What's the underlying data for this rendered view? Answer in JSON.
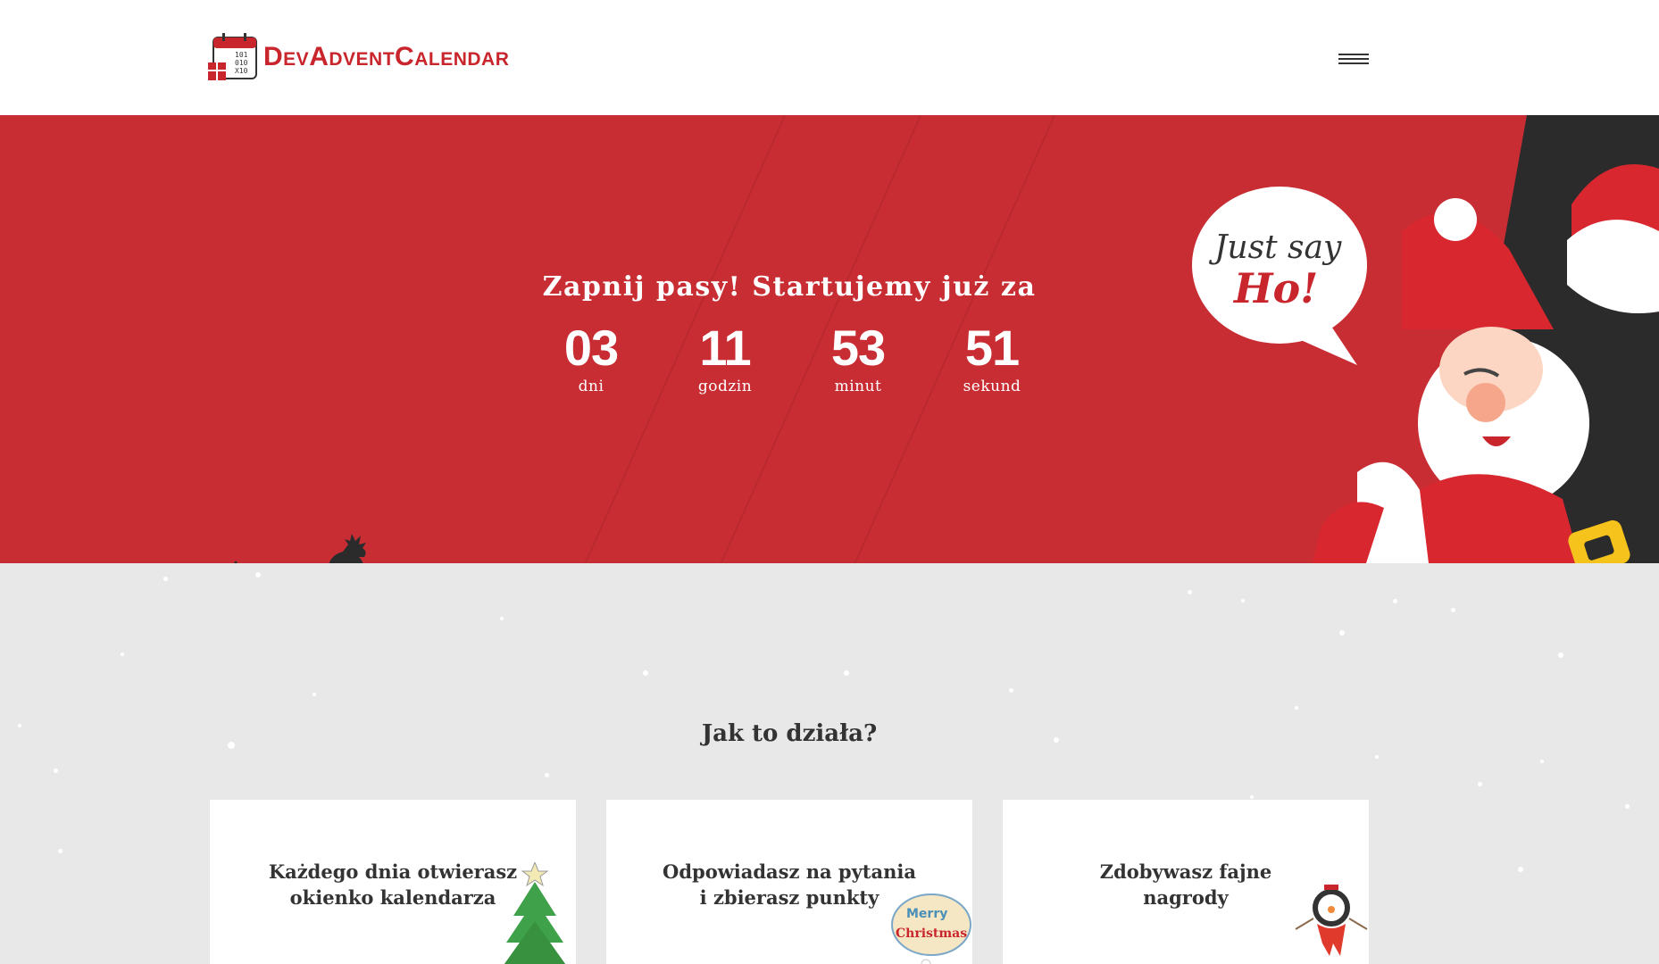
{
  "header": {
    "logo": {
      "dev": "Dev",
      "advent": "Advent",
      "calendar": "Calendar",
      "icon": "calendar-binary-icon",
      "calendar_digits": [
        "101",
        "010",
        "X10"
      ]
    },
    "menu_icon": "hamburger-icon"
  },
  "hero": {
    "title": "Zapnij pasy! Startujemy już za",
    "countdown": [
      {
        "value": "03",
        "label": "dni"
      },
      {
        "value": "11",
        "label": "godzin"
      },
      {
        "value": "53",
        "label": "minut"
      },
      {
        "value": "51",
        "label": "sekund"
      }
    ],
    "speech_bubble": {
      "line1": "Just say",
      "line2": "Ho!"
    },
    "illustrations": [
      "santa-claus-illustration",
      "reindeer-silhouette"
    ]
  },
  "how_it_works": {
    "title": "Jak to działa?",
    "cards": [
      {
        "text_line1": "Każdego dnia otwierasz",
        "text_line2": "okienko kalendarza",
        "icon": "christmas-tree-icon"
      },
      {
        "text_line1": "Odpowiadasz na pytania",
        "text_line2": "i zbierasz punkty",
        "icon": "merry-christmas-badge-icon",
        "badge_line1": "Merry",
        "badge_line2": "Christmas"
      },
      {
        "text_line1": "Zdobywasz fajne",
        "text_line2": "nagrody",
        "icon": "snowman-icon"
      }
    ]
  },
  "colors": {
    "brand_red": "#c92d34",
    "logo_red": "#c9252c",
    "background_gray": "#e8e8e8",
    "text_dark": "#333333",
    "santa_dark": "#2b2b2b"
  }
}
